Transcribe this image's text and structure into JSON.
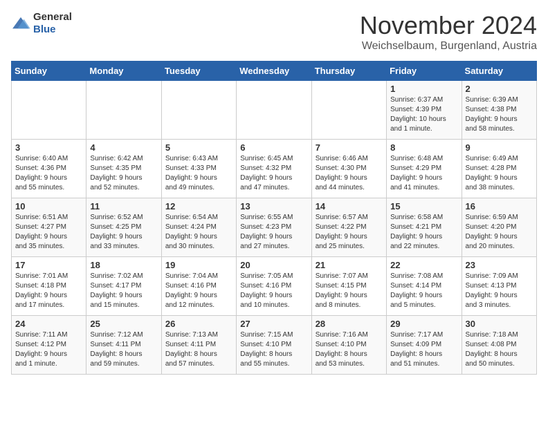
{
  "logo": {
    "general": "General",
    "blue": "Blue"
  },
  "title": "November 2024",
  "location": "Weichselbaum, Burgenland, Austria",
  "headers": [
    "Sunday",
    "Monday",
    "Tuesday",
    "Wednesday",
    "Thursday",
    "Friday",
    "Saturday"
  ],
  "weeks": [
    [
      {
        "day": "",
        "info": ""
      },
      {
        "day": "",
        "info": ""
      },
      {
        "day": "",
        "info": ""
      },
      {
        "day": "",
        "info": ""
      },
      {
        "day": "",
        "info": ""
      },
      {
        "day": "1",
        "info": "Sunrise: 6:37 AM\nSunset: 4:39 PM\nDaylight: 10 hours\nand 1 minute."
      },
      {
        "day": "2",
        "info": "Sunrise: 6:39 AM\nSunset: 4:38 PM\nDaylight: 9 hours\nand 58 minutes."
      }
    ],
    [
      {
        "day": "3",
        "info": "Sunrise: 6:40 AM\nSunset: 4:36 PM\nDaylight: 9 hours\nand 55 minutes."
      },
      {
        "day": "4",
        "info": "Sunrise: 6:42 AM\nSunset: 4:35 PM\nDaylight: 9 hours\nand 52 minutes."
      },
      {
        "day": "5",
        "info": "Sunrise: 6:43 AM\nSunset: 4:33 PM\nDaylight: 9 hours\nand 49 minutes."
      },
      {
        "day": "6",
        "info": "Sunrise: 6:45 AM\nSunset: 4:32 PM\nDaylight: 9 hours\nand 47 minutes."
      },
      {
        "day": "7",
        "info": "Sunrise: 6:46 AM\nSunset: 4:30 PM\nDaylight: 9 hours\nand 44 minutes."
      },
      {
        "day": "8",
        "info": "Sunrise: 6:48 AM\nSunset: 4:29 PM\nDaylight: 9 hours\nand 41 minutes."
      },
      {
        "day": "9",
        "info": "Sunrise: 6:49 AM\nSunset: 4:28 PM\nDaylight: 9 hours\nand 38 minutes."
      }
    ],
    [
      {
        "day": "10",
        "info": "Sunrise: 6:51 AM\nSunset: 4:27 PM\nDaylight: 9 hours\nand 35 minutes."
      },
      {
        "day": "11",
        "info": "Sunrise: 6:52 AM\nSunset: 4:25 PM\nDaylight: 9 hours\nand 33 minutes."
      },
      {
        "day": "12",
        "info": "Sunrise: 6:54 AM\nSunset: 4:24 PM\nDaylight: 9 hours\nand 30 minutes."
      },
      {
        "day": "13",
        "info": "Sunrise: 6:55 AM\nSunset: 4:23 PM\nDaylight: 9 hours\nand 27 minutes."
      },
      {
        "day": "14",
        "info": "Sunrise: 6:57 AM\nSunset: 4:22 PM\nDaylight: 9 hours\nand 25 minutes."
      },
      {
        "day": "15",
        "info": "Sunrise: 6:58 AM\nSunset: 4:21 PM\nDaylight: 9 hours\nand 22 minutes."
      },
      {
        "day": "16",
        "info": "Sunrise: 6:59 AM\nSunset: 4:20 PM\nDaylight: 9 hours\nand 20 minutes."
      }
    ],
    [
      {
        "day": "17",
        "info": "Sunrise: 7:01 AM\nSunset: 4:18 PM\nDaylight: 9 hours\nand 17 minutes."
      },
      {
        "day": "18",
        "info": "Sunrise: 7:02 AM\nSunset: 4:17 PM\nDaylight: 9 hours\nand 15 minutes."
      },
      {
        "day": "19",
        "info": "Sunrise: 7:04 AM\nSunset: 4:16 PM\nDaylight: 9 hours\nand 12 minutes."
      },
      {
        "day": "20",
        "info": "Sunrise: 7:05 AM\nSunset: 4:16 PM\nDaylight: 9 hours\nand 10 minutes."
      },
      {
        "day": "21",
        "info": "Sunrise: 7:07 AM\nSunset: 4:15 PM\nDaylight: 9 hours\nand 8 minutes."
      },
      {
        "day": "22",
        "info": "Sunrise: 7:08 AM\nSunset: 4:14 PM\nDaylight: 9 hours\nand 5 minutes."
      },
      {
        "day": "23",
        "info": "Sunrise: 7:09 AM\nSunset: 4:13 PM\nDaylight: 9 hours\nand 3 minutes."
      }
    ],
    [
      {
        "day": "24",
        "info": "Sunrise: 7:11 AM\nSunset: 4:12 PM\nDaylight: 9 hours\nand 1 minute."
      },
      {
        "day": "25",
        "info": "Sunrise: 7:12 AM\nSunset: 4:11 PM\nDaylight: 8 hours\nand 59 minutes."
      },
      {
        "day": "26",
        "info": "Sunrise: 7:13 AM\nSunset: 4:11 PM\nDaylight: 8 hours\nand 57 minutes."
      },
      {
        "day": "27",
        "info": "Sunrise: 7:15 AM\nSunset: 4:10 PM\nDaylight: 8 hours\nand 55 minutes."
      },
      {
        "day": "28",
        "info": "Sunrise: 7:16 AM\nSunset: 4:10 PM\nDaylight: 8 hours\nand 53 minutes."
      },
      {
        "day": "29",
        "info": "Sunrise: 7:17 AM\nSunset: 4:09 PM\nDaylight: 8 hours\nand 51 minutes."
      },
      {
        "day": "30",
        "info": "Sunrise: 7:18 AM\nSunset: 4:08 PM\nDaylight: 8 hours\nand 50 minutes."
      }
    ]
  ]
}
